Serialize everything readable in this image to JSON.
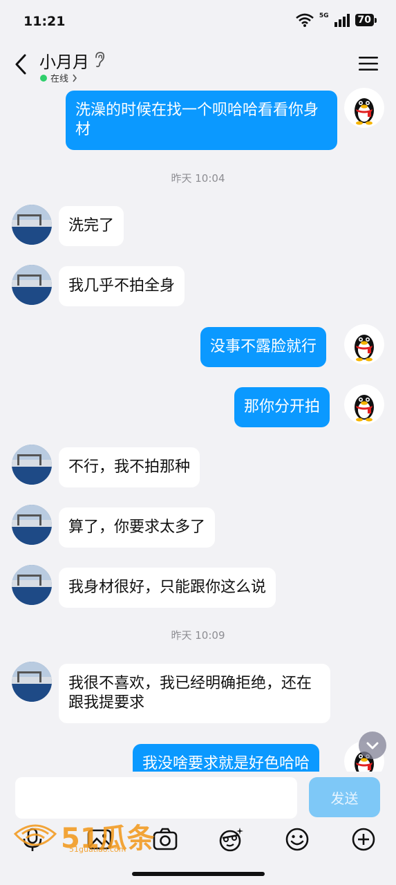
{
  "status_bar": {
    "time": "11:21",
    "network": "5G",
    "battery": "70"
  },
  "header": {
    "contact_name": "小月月",
    "status": "在线"
  },
  "messages": [
    {
      "side": "out",
      "text": "洗澡的时候在找一个呗哈哈看看你身材"
    },
    {
      "side": "ts",
      "text": "昨天 10:04"
    },
    {
      "side": "in",
      "text": "洗完了"
    },
    {
      "side": "in",
      "text": "我几乎不拍全身"
    },
    {
      "side": "out",
      "text": "没事不露脸就行"
    },
    {
      "side": "out",
      "text": "那你分开拍"
    },
    {
      "side": "in",
      "text": "不行，我不拍那种"
    },
    {
      "side": "in",
      "text": "算了，你要求太多了"
    },
    {
      "side": "in",
      "text": "我身材很好，只能跟你这么说"
    },
    {
      "side": "ts",
      "text": "昨天 10:09"
    },
    {
      "side": "in",
      "text": "我很不喜欢，我已经明确拒绝，还在跟我提要求"
    },
    {
      "side": "out",
      "text": "我没啥要求就是好色哈哈"
    }
  ],
  "input": {
    "placeholder": "",
    "send_label": "发送"
  },
  "watermark": {
    "text": "51瓜条",
    "url": "51guatiao.com"
  },
  "colors": {
    "outgoing_bubble": "#0b99ff",
    "incoming_bubble": "#ffffff",
    "background": "#f2f2f5",
    "send_disabled": "#7ec8f7"
  }
}
